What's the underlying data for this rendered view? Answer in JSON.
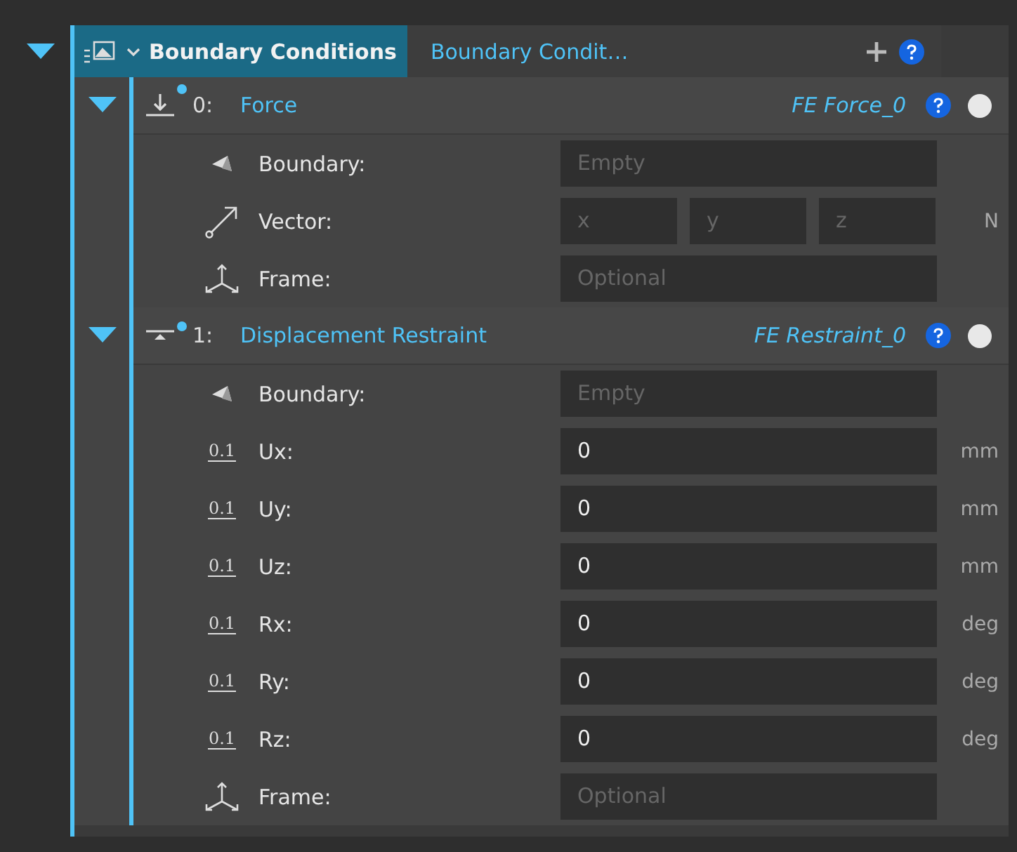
{
  "group": {
    "title": "Boundary Conditions",
    "name": "Boundary Condit…",
    "expanded": true,
    "items": [
      {
        "index": "0:",
        "kind": "force",
        "title": "Force",
        "name": "FE Force_0",
        "expanded": true,
        "modified": true,
        "enabled": true,
        "fields": [
          {
            "kind": "boundary",
            "label": "Boundary:",
            "placeholder": "Empty"
          },
          {
            "kind": "vector",
            "label": "Vector:",
            "components": [
              {
                "placeholder": "x"
              },
              {
                "placeholder": "y"
              },
              {
                "placeholder": "z"
              }
            ],
            "unit": "N"
          },
          {
            "kind": "frame",
            "label": "Frame:",
            "placeholder": "Optional"
          }
        ]
      },
      {
        "index": "1:",
        "kind": "restraint",
        "title": "Displacement Restraint",
        "name": "FE Restraint_0",
        "expanded": true,
        "modified": true,
        "enabled": true,
        "fields": [
          {
            "kind": "boundary",
            "label": "Boundary:",
            "placeholder": "Empty"
          },
          {
            "kind": "numeric",
            "mark": "0.1",
            "label": "Ux:",
            "value": "0",
            "unit": "mm"
          },
          {
            "kind": "numeric",
            "mark": "0.1",
            "label": "Uy:",
            "value": "0",
            "unit": "mm"
          },
          {
            "kind": "numeric",
            "mark": "0.1",
            "label": "Uz:",
            "value": "0",
            "unit": "mm"
          },
          {
            "kind": "numeric",
            "mark": "0.1",
            "label": "Rx:",
            "value": "0",
            "unit": "deg"
          },
          {
            "kind": "numeric",
            "mark": "0.1",
            "label": "Ry:",
            "value": "0",
            "unit": "deg"
          },
          {
            "kind": "numeric",
            "mark": "0.1",
            "label": "Rz:",
            "value": "0",
            "unit": "deg"
          },
          {
            "kind": "frame",
            "label": "Frame:",
            "placeholder": "Optional"
          }
        ]
      }
    ]
  }
}
